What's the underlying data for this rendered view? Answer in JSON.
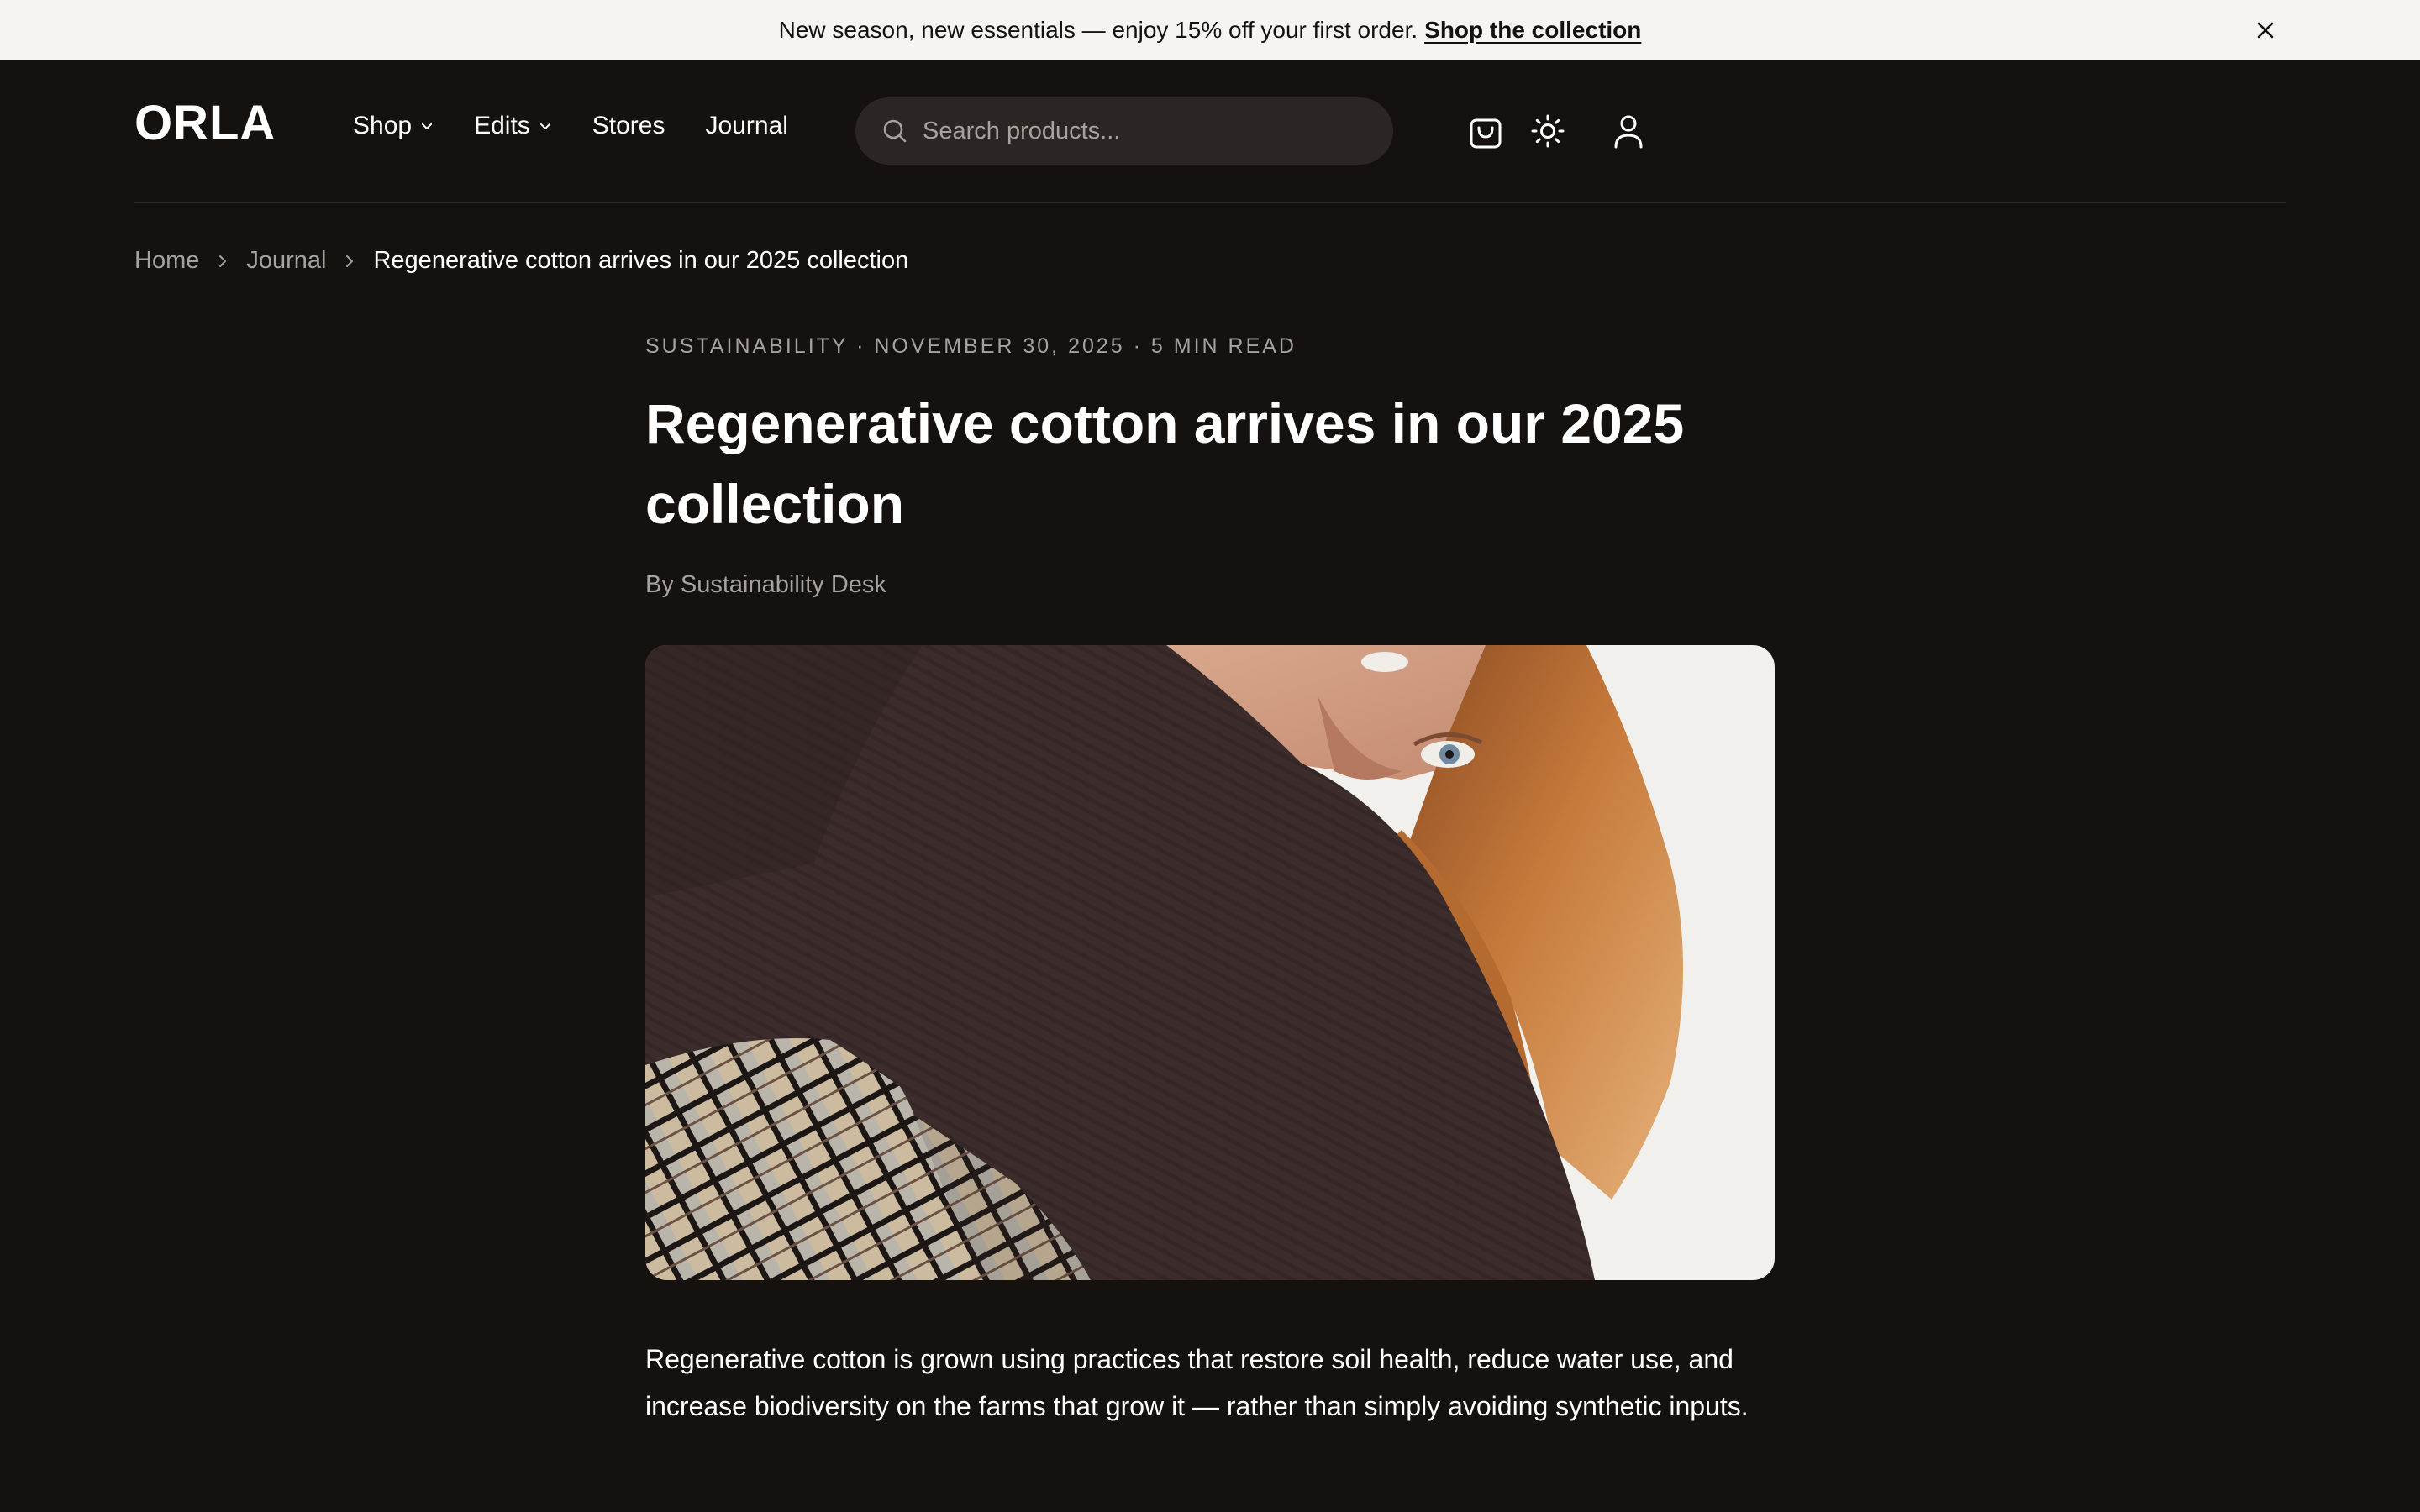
{
  "announcement": {
    "text": "New season, new essentials — enjoy 15% off your first order.",
    "link": "Shop the collection",
    "close_icon": "close-icon"
  },
  "header": {
    "logo": "ORLA",
    "nav": [
      {
        "label": "Shop",
        "has_dropdown": true
      },
      {
        "label": "Edits",
        "has_dropdown": true
      },
      {
        "label": "Stores",
        "has_dropdown": false
      },
      {
        "label": "Journal",
        "has_dropdown": false
      }
    ],
    "search_placeholder": "Search products...",
    "icons": [
      "shopping-bag-icon",
      "sun-icon",
      "user-icon"
    ]
  },
  "breadcrumb": [
    "Home",
    "Journal",
    "Regenerative cotton arrives in our 2025 collection"
  ],
  "article": {
    "meta": "SUSTAINABILITY · NOVEMBER 30, 2025 · 5 MIN READ",
    "title": "Regenerative cotton arrives in our 2025 collection",
    "byline": "By Sustainability Desk",
    "intro": "Regenerative cotton is grown using practices that restore soil health, reduce water use, and increase biodiversity on the farms that grow it — rather than simply avoiding synthetic inputs."
  },
  "colors": {
    "background": "#15110f",
    "announcement_bg": "#f5f4f1",
    "search_bg": "#2b2624",
    "muted_text": "#a8a29e"
  }
}
